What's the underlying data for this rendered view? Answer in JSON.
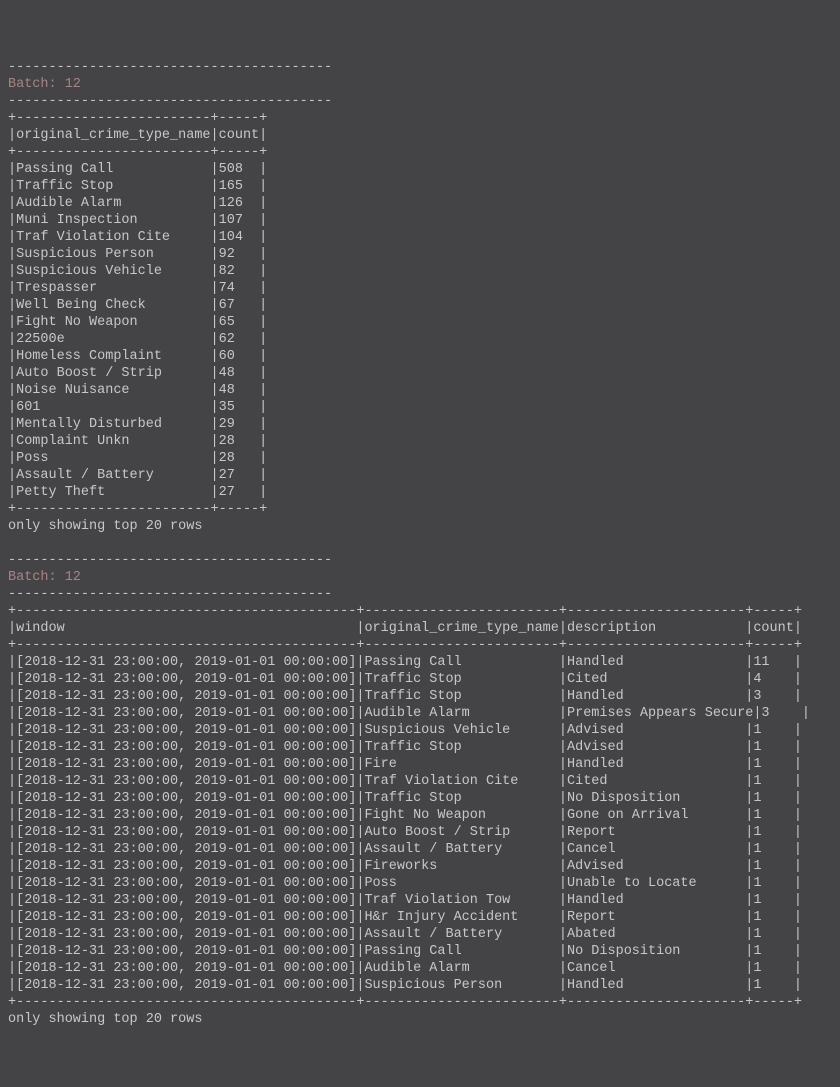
{
  "sep40": "----------------------------------------",
  "batch1": {
    "label": "Batch: 12",
    "headers": [
      "original_crime_type_name",
      "count"
    ],
    "widths": [
      24,
      5
    ],
    "rows": [
      [
        "Passing Call",
        "508"
      ],
      [
        "Traffic Stop",
        "165"
      ],
      [
        "Audible Alarm",
        "126"
      ],
      [
        "Muni Inspection",
        "107"
      ],
      [
        "Traf Violation Cite",
        "104"
      ],
      [
        "Suspicious Person",
        "92"
      ],
      [
        "Suspicious Vehicle",
        "82"
      ],
      [
        "Trespasser",
        "74"
      ],
      [
        "Well Being Check",
        "67"
      ],
      [
        "Fight No Weapon",
        "65"
      ],
      [
        "22500e",
        "62"
      ],
      [
        "Homeless Complaint",
        "60"
      ],
      [
        "Auto Boost / Strip",
        "48"
      ],
      [
        "Noise Nuisance",
        "48"
      ],
      [
        "601",
        "35"
      ],
      [
        "Mentally Disturbed",
        "29"
      ],
      [
        "Complaint Unkn",
        "28"
      ],
      [
        "Poss",
        "28"
      ],
      [
        "Assault / Battery",
        "27"
      ],
      [
        "Petty Theft",
        "27"
      ]
    ],
    "footer": "only showing top 20 rows"
  },
  "batch2": {
    "label": "Batch: 12",
    "headers": [
      "window",
      "original_crime_type_name",
      "description",
      "count"
    ],
    "widths": [
      42,
      24,
      22,
      5
    ],
    "window_value": "[2018-12-31 23:00:00, 2019-01-01 00:00:00]",
    "rows": [
      [
        "[2018-12-31 23:00:00, 2019-01-01 00:00:00]",
        "Passing Call",
        "Handled",
        "11"
      ],
      [
        "[2018-12-31 23:00:00, 2019-01-01 00:00:00]",
        "Traffic Stop",
        "Cited",
        "4"
      ],
      [
        "[2018-12-31 23:00:00, 2019-01-01 00:00:00]",
        "Traffic Stop",
        "Handled",
        "3"
      ],
      [
        "[2018-12-31 23:00:00, 2019-01-01 00:00:00]",
        "Audible Alarm",
        "Premises Appears Secure",
        "3"
      ],
      [
        "[2018-12-31 23:00:00, 2019-01-01 00:00:00]",
        "Suspicious Vehicle",
        "Advised",
        "1"
      ],
      [
        "[2018-12-31 23:00:00, 2019-01-01 00:00:00]",
        "Traffic Stop",
        "Advised",
        "1"
      ],
      [
        "[2018-12-31 23:00:00, 2019-01-01 00:00:00]",
        "Fire",
        "Handled",
        "1"
      ],
      [
        "[2018-12-31 23:00:00, 2019-01-01 00:00:00]",
        "Traf Violation Cite",
        "Cited",
        "1"
      ],
      [
        "[2018-12-31 23:00:00, 2019-01-01 00:00:00]",
        "Traffic Stop",
        "No Disposition",
        "1"
      ],
      [
        "[2018-12-31 23:00:00, 2019-01-01 00:00:00]",
        "Fight No Weapon",
        "Gone on Arrival",
        "1"
      ],
      [
        "[2018-12-31 23:00:00, 2019-01-01 00:00:00]",
        "Auto Boost / Strip",
        "Report",
        "1"
      ],
      [
        "[2018-12-31 23:00:00, 2019-01-01 00:00:00]",
        "Assault / Battery",
        "Cancel",
        "1"
      ],
      [
        "[2018-12-31 23:00:00, 2019-01-01 00:00:00]",
        "Fireworks",
        "Advised",
        "1"
      ],
      [
        "[2018-12-31 23:00:00, 2019-01-01 00:00:00]",
        "Poss",
        "Unable to Locate",
        "1"
      ],
      [
        "[2018-12-31 23:00:00, 2019-01-01 00:00:00]",
        "Traf Violation Tow",
        "Handled",
        "1"
      ],
      [
        "[2018-12-31 23:00:00, 2019-01-01 00:00:00]",
        "H&r Injury Accident",
        "Report",
        "1"
      ],
      [
        "[2018-12-31 23:00:00, 2019-01-01 00:00:00]",
        "Assault / Battery",
        "Abated",
        "1"
      ],
      [
        "[2018-12-31 23:00:00, 2019-01-01 00:00:00]",
        "Passing Call",
        "No Disposition",
        "1"
      ],
      [
        "[2018-12-31 23:00:00, 2019-01-01 00:00:00]",
        "Audible Alarm",
        "Cancel",
        "1"
      ],
      [
        "[2018-12-31 23:00:00, 2019-01-01 00:00:00]",
        "Suspicious Person",
        "Handled",
        "1"
      ]
    ],
    "footer": "only showing top 20 rows"
  }
}
